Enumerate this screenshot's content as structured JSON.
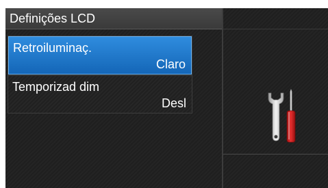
{
  "header": {
    "title": "Definições LCD"
  },
  "menu": {
    "items": [
      {
        "label": "Retroiluminaç.",
        "value": "Claro",
        "selected": true
      },
      {
        "label": "Temporizad dim",
        "value": "Desl",
        "selected": false
      }
    ]
  },
  "icons": {
    "tools": "wrench-screwdriver-icon"
  },
  "colors": {
    "selected_item": "#1f78cf",
    "screwdriver_handle": "#d42020"
  }
}
